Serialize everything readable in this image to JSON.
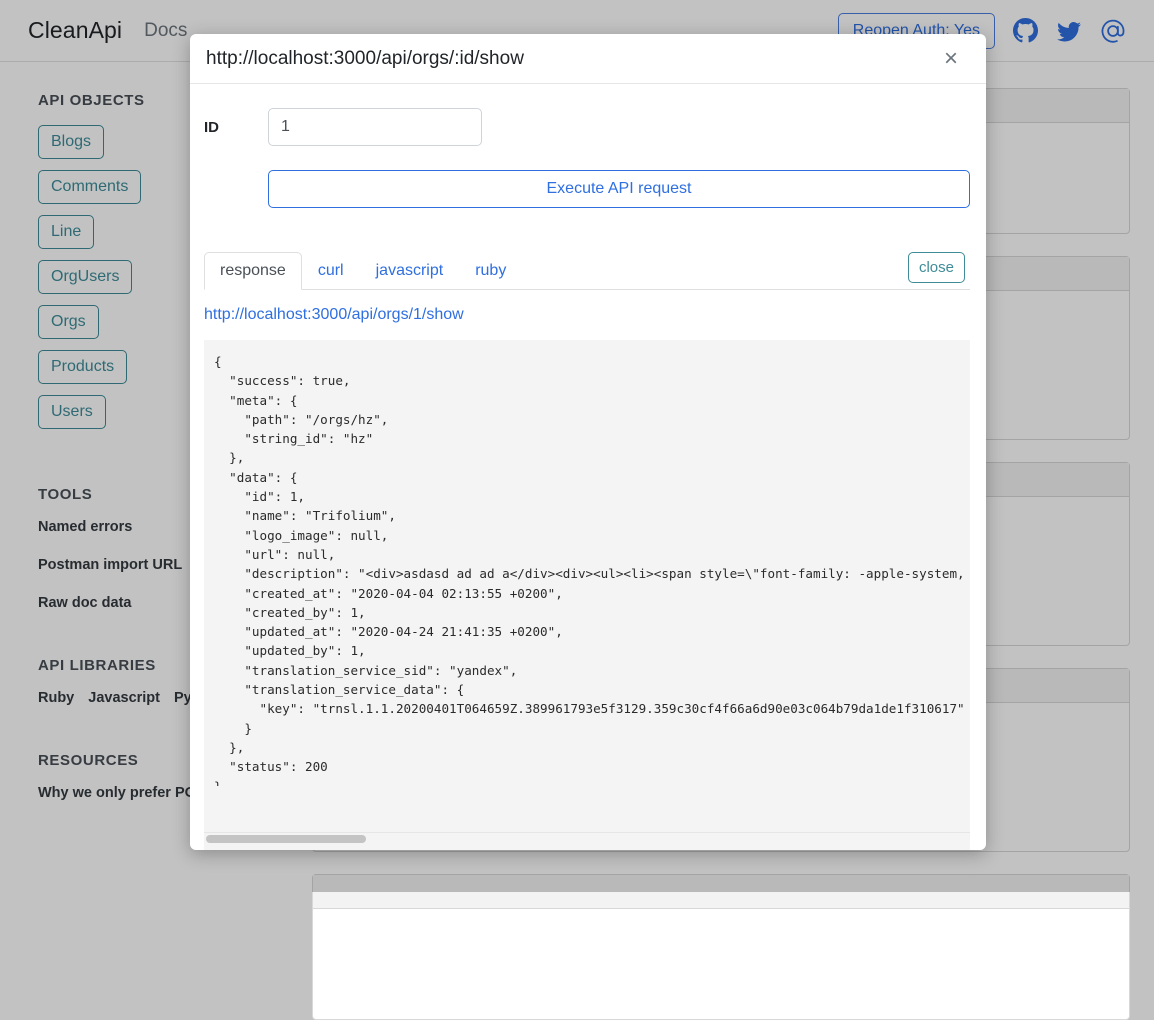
{
  "topbar": {
    "brand": "CleanApi",
    "nav_docs": "Docs",
    "auth_button": "Reopen Auth: Yes",
    "icons": [
      "github-icon",
      "twitter-icon",
      "at-icon"
    ]
  },
  "sidebar": {
    "sections": [
      {
        "heading": "API OBJECTS",
        "items": [
          "Blogs",
          "Comments",
          "Line",
          "OrgUsers",
          "Orgs",
          "Products",
          "Users"
        ]
      },
      {
        "heading": "TOOLS",
        "items": [
          "Named errors",
          "Postman import URL",
          "Raw doc data"
        ]
      },
      {
        "heading": "API LIBRARIES",
        "items": [
          "Ruby",
          "Javascript",
          "Python"
        ]
      },
      {
        "heading": "RESOURCES",
        "items": [
          "Why we only prefer POST?"
        ]
      }
    ]
  },
  "modal": {
    "title": "http://localhost:3000/api/orgs/:id/show",
    "close_glyph": "×",
    "form": {
      "id_label": "ID",
      "id_value": "1",
      "id_placeholder": "",
      "execute_label": "Execute API request"
    },
    "tabs": [
      {
        "label": "response",
        "active": true
      },
      {
        "label": "curl",
        "active": false
      },
      {
        "label": "javascript",
        "active": false
      },
      {
        "label": "ruby",
        "active": false
      }
    ],
    "close_tab_label": "close",
    "response_url": "http://localhost:3000/api/orgs/1/show",
    "response_body": "{\n  \"success\": true,\n  \"meta\": {\n    \"path\": \"/orgs/hz\",\n    \"string_id\": \"hz\"\n  },\n  \"data\": {\n    \"id\": 1,\n    \"name\": \"Trifolium\",\n    \"logo_image\": null,\n    \"url\": null,\n    \"description\": \"<div>asdasd ad ad a</div><div><ul><li><span style=\\\"font-family: -apple-system, BlinkMacSystemFont\",\n    \"created_at\": \"2020-04-04 02:13:55 +0200\",\n    \"created_by\": 1,\n    \"updated_at\": \"2020-04-24 21:41:35 +0200\",\n    \"updated_by\": 1,\n    \"translation_service_sid\": \"yandex\",\n    \"translation_service_data\": {\n      \"key\": \"trnsl.1.1.20200401T064659Z.389961793e5f3129.359c30cf4f66a6d90e03c064b79da1de1f310617\"\n    }\n  },\n  \"status\": 200\n}"
  },
  "colors": {
    "accent_blue": "#2f6fe0",
    "accent_teal": "#3f8c99",
    "page_bg": "#c2c2c2",
    "code_bg": "#f4f4f4"
  }
}
